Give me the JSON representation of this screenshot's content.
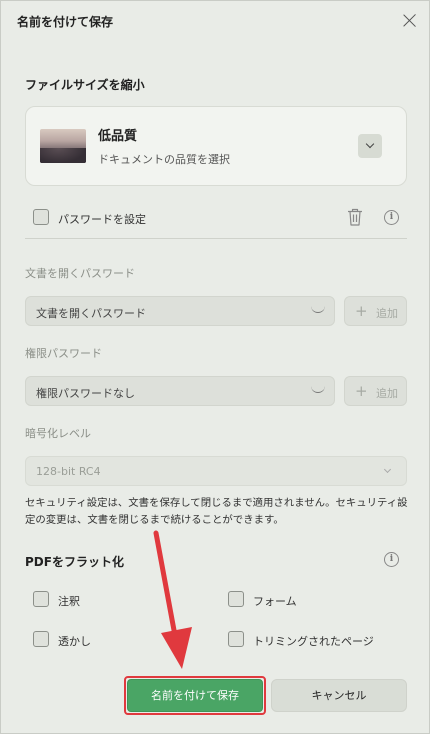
{
  "dialog": {
    "title": "名前を付けて保存"
  },
  "reduce_size": {
    "section_label": "ファイルサイズを縮小",
    "quality_title": "低品質",
    "quality_subtitle": "ドキュメントの品質を選択"
  },
  "password": {
    "checkbox_label": "パスワードを設定",
    "checked": false,
    "open_label": "文書を開くパスワード",
    "open_value": "文書を開くパスワード",
    "permission_label": "権限パスワード",
    "permission_value": "権限パスワードなし",
    "add_label": "追加",
    "encryption_label": "暗号化レベル",
    "encryption_value": "128-bit RC4",
    "note": "セキュリティ設定は、文書を保存して閉じるまで適用されません。セキュリティ設定の変更は、文書を閉じるまで続けることができます。"
  },
  "flatten": {
    "section_label": "PDFをフラット化",
    "options": {
      "annotations": "注釈",
      "form": "フォーム",
      "watermark": "透かし",
      "cropped_pages": "トリミングされたページ"
    }
  },
  "buttons": {
    "save": "名前を付けて保存",
    "cancel": "キャンセル"
  },
  "colors": {
    "primary_button": "#4aa565",
    "highlight": "#e0393e",
    "background": "#e9ece7"
  },
  "icons": [
    "close-icon",
    "chevron-down-icon",
    "trash-icon",
    "info-icon",
    "plus-icon",
    "arrow-annotation"
  ]
}
